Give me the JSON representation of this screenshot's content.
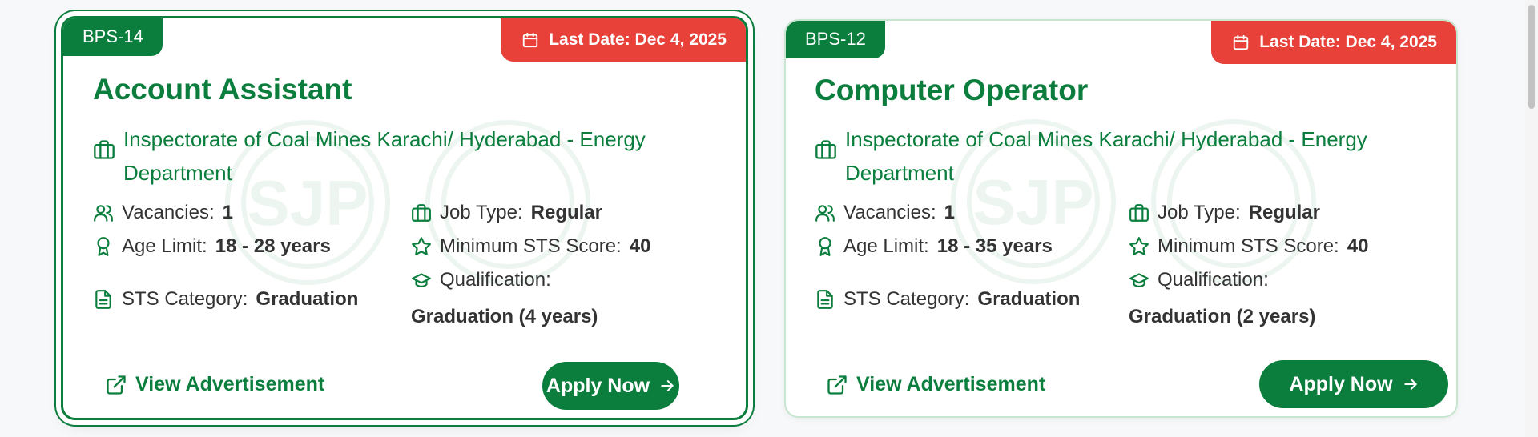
{
  "colors": {
    "brand_green": "#0b7e3d",
    "deadline_red": "#e8413a",
    "card_border": "#c7e6cf"
  },
  "watermark": {
    "text": "SJP"
  },
  "jobs": [
    {
      "bps": "BPS-14",
      "deadline": "Last Date: Dec 4, 2025",
      "title": "Account Assistant",
      "department": "Inspectorate of Coal Mines Karachi/ Hyderabad - Energy Department",
      "vacancies_label": "Vacancies:",
      "vacancies": "1",
      "age_label": "Age Limit:",
      "age": "18 - 28 years",
      "sts_category_label": "STS Category:",
      "sts_category": "Graduation",
      "job_type_label": "Job Type:",
      "job_type": "Regular",
      "min_sts_label": "Minimum STS Score:",
      "min_sts": "40",
      "qualification_label": "Qualification:",
      "qualification": "Graduation (4 years)",
      "view_ad": "View Advertisement",
      "apply": "Apply Now"
    },
    {
      "bps": "BPS-12",
      "deadline": "Last Date: Dec 4, 2025",
      "title": "Computer Operator",
      "department": "Inspectorate of Coal Mines Karachi/ Hyderabad - Energy Department",
      "vacancies_label": "Vacancies:",
      "vacancies": "1",
      "age_label": "Age Limit:",
      "age": "18 - 35 years",
      "sts_category_label": "STS Category:",
      "sts_category": "Graduation",
      "job_type_label": "Job Type:",
      "job_type": "Regular",
      "min_sts_label": "Minimum STS Score:",
      "min_sts": "40",
      "qualification_label": "Qualification:",
      "qualification": "Graduation (2 years)",
      "view_ad": "View Advertisement",
      "apply": "Apply Now"
    }
  ]
}
